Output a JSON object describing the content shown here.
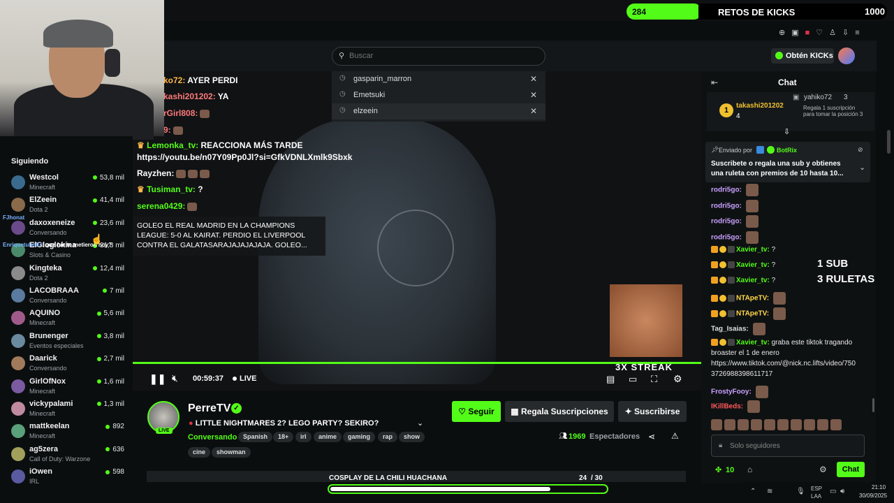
{
  "kicks_bar": {
    "count": "284",
    "title": "RETOS DE KICKS",
    "goal": "1000"
  },
  "search": {
    "placeholder": "Buscar"
  },
  "search_history": [
    {
      "label": "gasparin_marron"
    },
    {
      "label": "Emetsuki"
    },
    {
      "label": "elzeein"
    }
  ],
  "header": {
    "get_kicks": "Obtén KICKs"
  },
  "overlay_chat": [
    {
      "user": "ko72:",
      "text": "AYER PERDI"
    },
    {
      "user": "kashi201202:",
      "text": "YA"
    },
    {
      "user": "rGirl808:",
      "text": ""
    },
    {
      "user": "9:",
      "text": ""
    },
    {
      "user": "Lemonka_tv:",
      "text": "REACCIONA MÁS TARDE"
    },
    {
      "user": "",
      "text": "https://youtu.be/n07Y09Pp0Jl?si=GfkVDNLXmlk9Sbxk"
    },
    {
      "user": "Rayzhen:",
      "text": ""
    },
    {
      "user": "Tusiman_tv:",
      "text": "?"
    },
    {
      "user": "serena0429:",
      "text": ""
    }
  ],
  "overlay_notice": "GOLEO EL REAL MADRID EN LA CHAMPIONS LEAGUE: 5-0 AL KAIRAT. PERDIO EL LIVERPOOL CONTRA EL GALATASARAJAJAJAJAJA. GOLEO...",
  "streak": "3X STREAK",
  "overlay_promo": [
    "1 SUB",
    "3 RULETAS"
  ],
  "player": {
    "time": "00:59:37",
    "live": "LIVE"
  },
  "following": {
    "title": "Siguiendo",
    "items": [
      {
        "name": "Westcol",
        "category": "Minecraft",
        "viewers": "53,8 mil",
        "color": "#3a6b8f"
      },
      {
        "name": "ElZeein",
        "category": "Dota 2",
        "viewers": "41,4 mil",
        "color": "#8a6a4a"
      },
      {
        "name": "daxoxeneize",
        "category": "Conversando",
        "viewers": "23,6 mil",
        "color": "#6a4a8a"
      },
      {
        "name": "ElGloglokina",
        "category": "Slots & Casino",
        "viewers": "21,3 mil",
        "color": "#4a8a6a"
      },
      {
        "name": "Kingteka",
        "category": "Dota 2",
        "viewers": "12,4 mil",
        "color": "#8a8a8a"
      },
      {
        "name": "LACOBRAAA",
        "category": "Conversando",
        "viewers": "7 mil",
        "color": "#5a7aa0"
      },
      {
        "name": "AQUINO",
        "category": "Minecraft",
        "viewers": "5,6 mil",
        "color": "#a05a8a"
      },
      {
        "name": "Brunenger",
        "category": "Eventos especiales",
        "viewers": "3,8 mil",
        "color": "#6a8aa0"
      },
      {
        "name": "Daarick",
        "category": "Conversando",
        "viewers": "2,7 mil",
        "color": "#a07a5a"
      },
      {
        "name": "GirlOfNox",
        "category": "Minecraft",
        "viewers": "1,6 mil",
        "color": "#7a5aa0"
      },
      {
        "name": "vickypalami",
        "category": "Minecraft",
        "viewers": "1,3 mil",
        "color": "#c08aa0"
      },
      {
        "name": "mattkeelan",
        "category": "Minecraft",
        "viewers": "892",
        "color": "#5aa07a"
      },
      {
        "name": "ag5zera",
        "category": "Call of Duty: Warzone",
        "viewers": "636",
        "color": "#a0a05a"
      },
      {
        "name": "iOwen",
        "category": "IRL",
        "viewers": "598",
        "color": "#5a5aa0"
      }
    ]
  },
  "sidebar_overlay": {
    "user": "FJhonat",
    "text": "que fue te metieron hoy?",
    "user2": "Enriquetubo97"
  },
  "channel": {
    "name": "PerreTV",
    "title": "LITTLE NIGHTMARES 2? LEGO PARTY? SEKIRO?",
    "category": "Conversando",
    "tags": [
      "Spanish",
      "18+",
      "irl",
      "anime",
      "gaming",
      "rap",
      "show",
      "cine",
      "showman"
    ],
    "viewers": "1969",
    "viewers_label": "Espectadores",
    "live_badge": "LIVE"
  },
  "actions": {
    "follow": "Seguir",
    "gift": "Regala Suscripciones",
    "subscribe": "Suscribirse"
  },
  "goal_bar": {
    "label": "COSPLAY DE LA CHILI HUACHANA",
    "current": "24",
    "total": "/ 30",
    "progress": 0.8
  },
  "chat": {
    "title": "Chat",
    "top_gifters": [
      {
        "name": "takashi201202",
        "count": "4"
      },
      {
        "name": "yahiko72",
        "count": "3"
      }
    ],
    "gift_note": "Regala 1 suscripción para tomar la posición 3",
    "pinned": {
      "sent_by": "Enviado por",
      "bot": "BotRix",
      "text": "Suscribete o regala una sub y obtienes una ruleta con premios de 10 hasta 10..."
    },
    "messages": [
      {
        "user": "rodri5go:",
        "text": "",
        "color": "#c9a0ff"
      },
      {
        "user": "rodri5go:",
        "text": "",
        "color": "#c9a0ff"
      },
      {
        "user": "rodri5go:",
        "text": "",
        "color": "#c9a0ff"
      },
      {
        "user": "rodri5go:",
        "text": "",
        "color": "#c9a0ff"
      },
      {
        "user": "Xavier_tv:",
        "text": "?",
        "color": "#53fc18"
      },
      {
        "user": "Xavier_tv:",
        "text": "?",
        "color": "#53fc18"
      },
      {
        "user": "Xavier_tv:",
        "text": "?",
        "color": "#53fc18"
      },
      {
        "user": "NTApeTV:",
        "text": "",
        "color": "#ffd84a"
      },
      {
        "user": "NTApeTV:",
        "text": "",
        "color": "#ffd84a"
      },
      {
        "user": "Tag_Isaias:",
        "text": "",
        "color": "#ddd"
      },
      {
        "user": "Xavier_tv:",
        "text": "graba este tiktok tragando",
        "color": "#53fc18"
      },
      {
        "user": "",
        "text": "broaster el 1 de enero",
        "color": "#ddd"
      },
      {
        "user": "",
        "text": "https://www.tiktok.com/@nick.nc.lifts/video/750",
        "color": "#ddd"
      },
      {
        "user": "",
        "text": "3726988398611717",
        "color": "#ddd"
      },
      {
        "user": "FrostyFooy:",
        "text": "",
        "color": "#c9a0ff"
      },
      {
        "user": "IKillBeds:",
        "text": "",
        "color": "#ff5a5a"
      }
    ],
    "input_placeholder": "Solo seguidores",
    "points": "10",
    "send": "Chat"
  },
  "taskbar": {
    "lang": "ESP",
    "layout": "LAA",
    "time": "21:10",
    "date": "30/09/2025"
  },
  "colors": {
    "accent": "#53fc18",
    "bg": "#0b0e0f"
  }
}
